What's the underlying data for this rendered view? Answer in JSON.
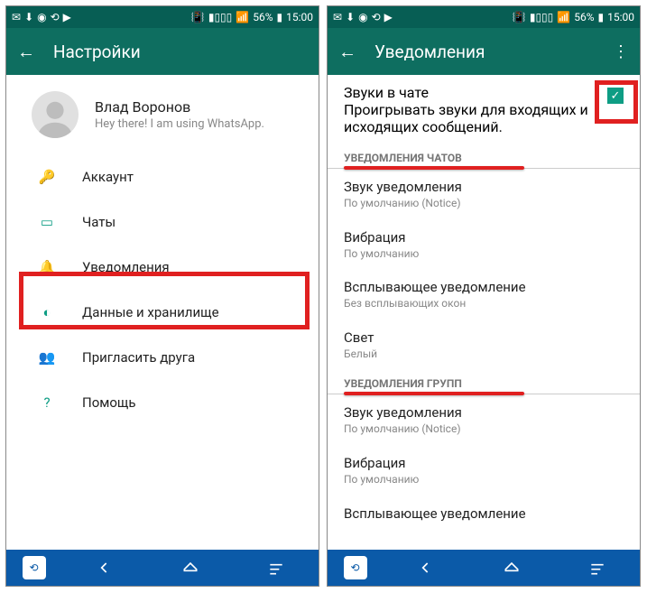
{
  "status": {
    "battery": "56%",
    "time": "15:00"
  },
  "left": {
    "title": "Настройки",
    "profile": {
      "name": "Влад Воронов",
      "status": "Hey there! I am using WhatsApp."
    },
    "items": [
      {
        "label": "Аккаунт"
      },
      {
        "label": "Чаты"
      },
      {
        "label": "Уведомления"
      },
      {
        "label": "Данные и хранилище"
      },
      {
        "label": "Пригласить друга"
      },
      {
        "label": "Помощь"
      }
    ]
  },
  "right": {
    "title": "Уведомления",
    "chat_sounds": {
      "title": "Звуки в чате",
      "subtitle": "Проигрывать звуки для входящих и исходящих сообщений."
    },
    "section1": "УВЕДОМЛЕНИЯ ЧАТОВ",
    "sound": {
      "title": "Звук уведомления",
      "subtitle": "По умолчанию (Notice)"
    },
    "vibration": {
      "title": "Вибрация",
      "subtitle": "По умолчанию"
    },
    "popup": {
      "title": "Всплывающее уведомление",
      "subtitle": "Без всплывающих окон"
    },
    "light": {
      "title": "Свет",
      "subtitle": "Белый"
    },
    "section2": "УВЕДОМЛЕНИЯ ГРУПП",
    "g_sound": {
      "title": "Звук уведомления",
      "subtitle": "По умолчанию (Notice)"
    },
    "g_vibration": {
      "title": "Вибрация",
      "subtitle": "По умолчанию"
    },
    "g_popup": {
      "title": "Всплывающее уведомление"
    }
  }
}
